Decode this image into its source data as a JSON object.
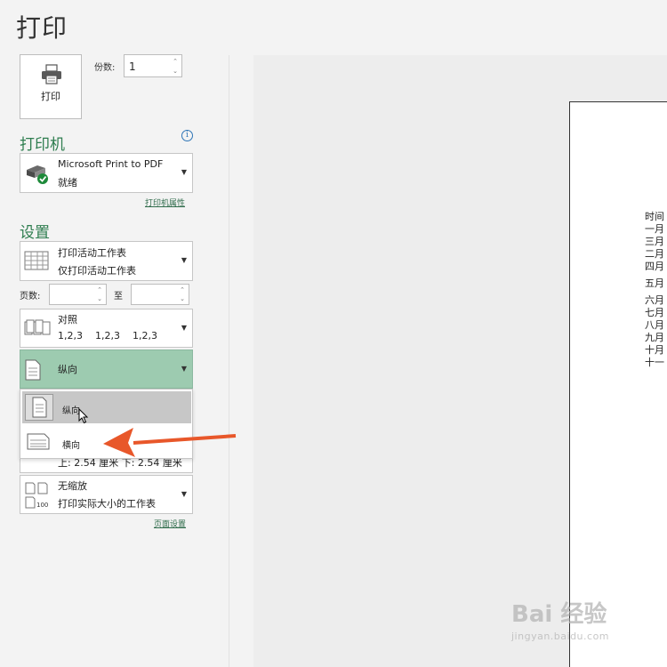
{
  "title": "打印",
  "print_button": {
    "label": "打印"
  },
  "copies": {
    "label": "份数:",
    "value": "1"
  },
  "printer": {
    "section_title": "打印机",
    "name": "Microsoft Print to PDF",
    "status": "就绪",
    "properties_link": "打印机属性"
  },
  "settings": {
    "section_title": "设置",
    "sheet": {
      "line1": "打印活动工作表",
      "line2": "仅打印活动工作表"
    },
    "pages": {
      "label": "页数:",
      "to_label": "至",
      "from_value": "",
      "to_value": ""
    },
    "collate": {
      "line1": "对照",
      "line2": "1,2,3    1,2,3    1,2,3"
    },
    "orientation": {
      "selected": "纵向"
    },
    "orientation_menu": {
      "portrait": "纵向",
      "landscape": "横向"
    },
    "margins": {
      "line1": "上: 2.54 厘米 下: 2.54 厘米"
    },
    "scaling": {
      "line1": "无缩放",
      "line2": "打印实际大小的工作表"
    },
    "page_setup_link": "页面设置"
  },
  "preview": {
    "lines": [
      "时间",
      "一月",
      "三月",
      "二月",
      "四月",
      "五月",
      "六月",
      "七月",
      "八月",
      "九月",
      "十月",
      "十一"
    ]
  },
  "watermark": {
    "main": "Bai 经验",
    "sub": "jingyan.baidu.com"
  },
  "colors": {
    "accent": "#2e7d4f",
    "selected_orientation_bg": "#9dcbb0",
    "arrow": "#e8572a"
  }
}
